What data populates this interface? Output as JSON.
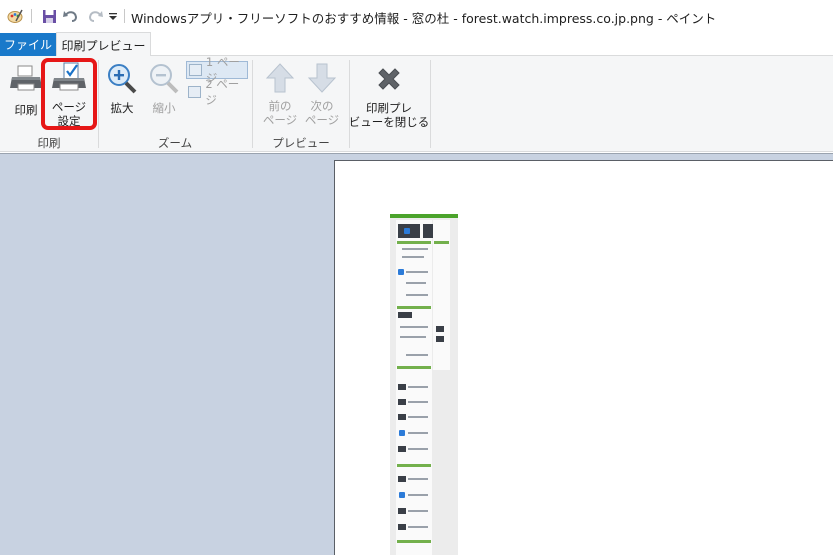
{
  "window": {
    "title": "Windowsアプリ・フリーソフトのおすすめ情報 - 窓の杜 - forest.watch.impress.co.jp.png - ペイント",
    "quick_access": [
      "paint-app-icon",
      "save-icon",
      "undo-icon",
      "redo-icon",
      "customize-dropdown-icon"
    ]
  },
  "tabs": {
    "file": "ファイル",
    "print_preview": "印刷プレビュー"
  },
  "ribbon": {
    "print_group": {
      "label": "印刷",
      "print": "印刷",
      "page_setup": "ページ\n設定"
    },
    "zoom_group": {
      "label": "ズーム",
      "zoom_in": "拡大",
      "zoom_out": "縮小",
      "one_page": "1 ページ",
      "two_pages": "2 ページ"
    },
    "preview_group": {
      "label": "プレビュー",
      "prev_page": "前の\nページ",
      "next_page": "次の\nページ",
      "close_preview": "印刷プレ\nビューを閉じる"
    }
  },
  "colors": {
    "accent": "#1979ca",
    "highlight": "#e61717",
    "workspace": "#c8d2e1"
  }
}
